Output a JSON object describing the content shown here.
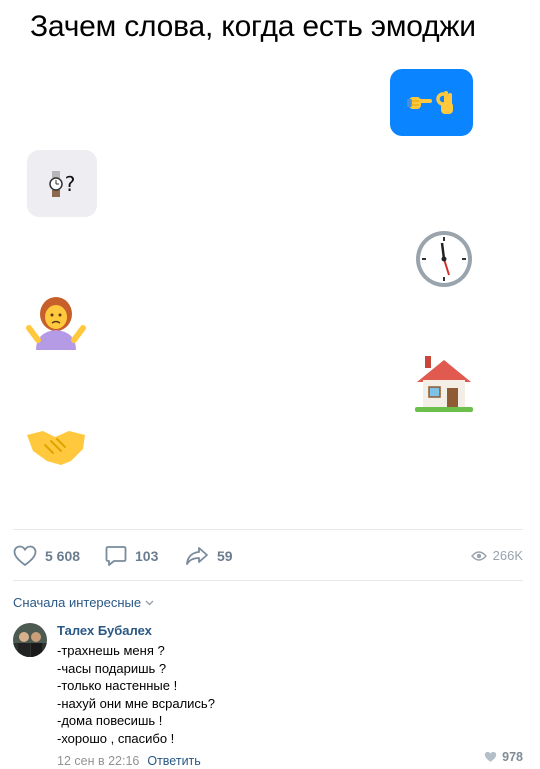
{
  "title": "Зачем слова, когда есть эмоджи",
  "chat": {
    "outgoing_message_emoji": [
      "point-right-emoji",
      "ok-hand-emoji"
    ],
    "incoming_message_emoji": "watch-emoji",
    "incoming_message_text": "?",
    "outgoing_color": "#0a84ff",
    "incoming_color": "#eeeef2",
    "emoji_sequence": [
      "clock-emoji",
      "woman-shrugging-emoji",
      "house-emoji",
      "handshake-emoji"
    ]
  },
  "post_stats": {
    "likes": "5 608",
    "comments": "103",
    "shares": "59",
    "views": "266K"
  },
  "comments_section": {
    "sort_label": "Сначала интересные",
    "comment": {
      "author": "Талех Бубалех",
      "lines": [
        "-трахнешь меня ?",
        "-часы подаришь ?",
        "-только настенные !",
        "-нахуй они мне всрались?",
        "-дома повесишь !",
        "-хорошо , спасибо !"
      ],
      "date": "12 сен в 22:16",
      "reply_label": "Ответить",
      "likes": "978"
    }
  },
  "colors": {
    "link": "#2a5885",
    "muted": "#6b7d8f"
  }
}
